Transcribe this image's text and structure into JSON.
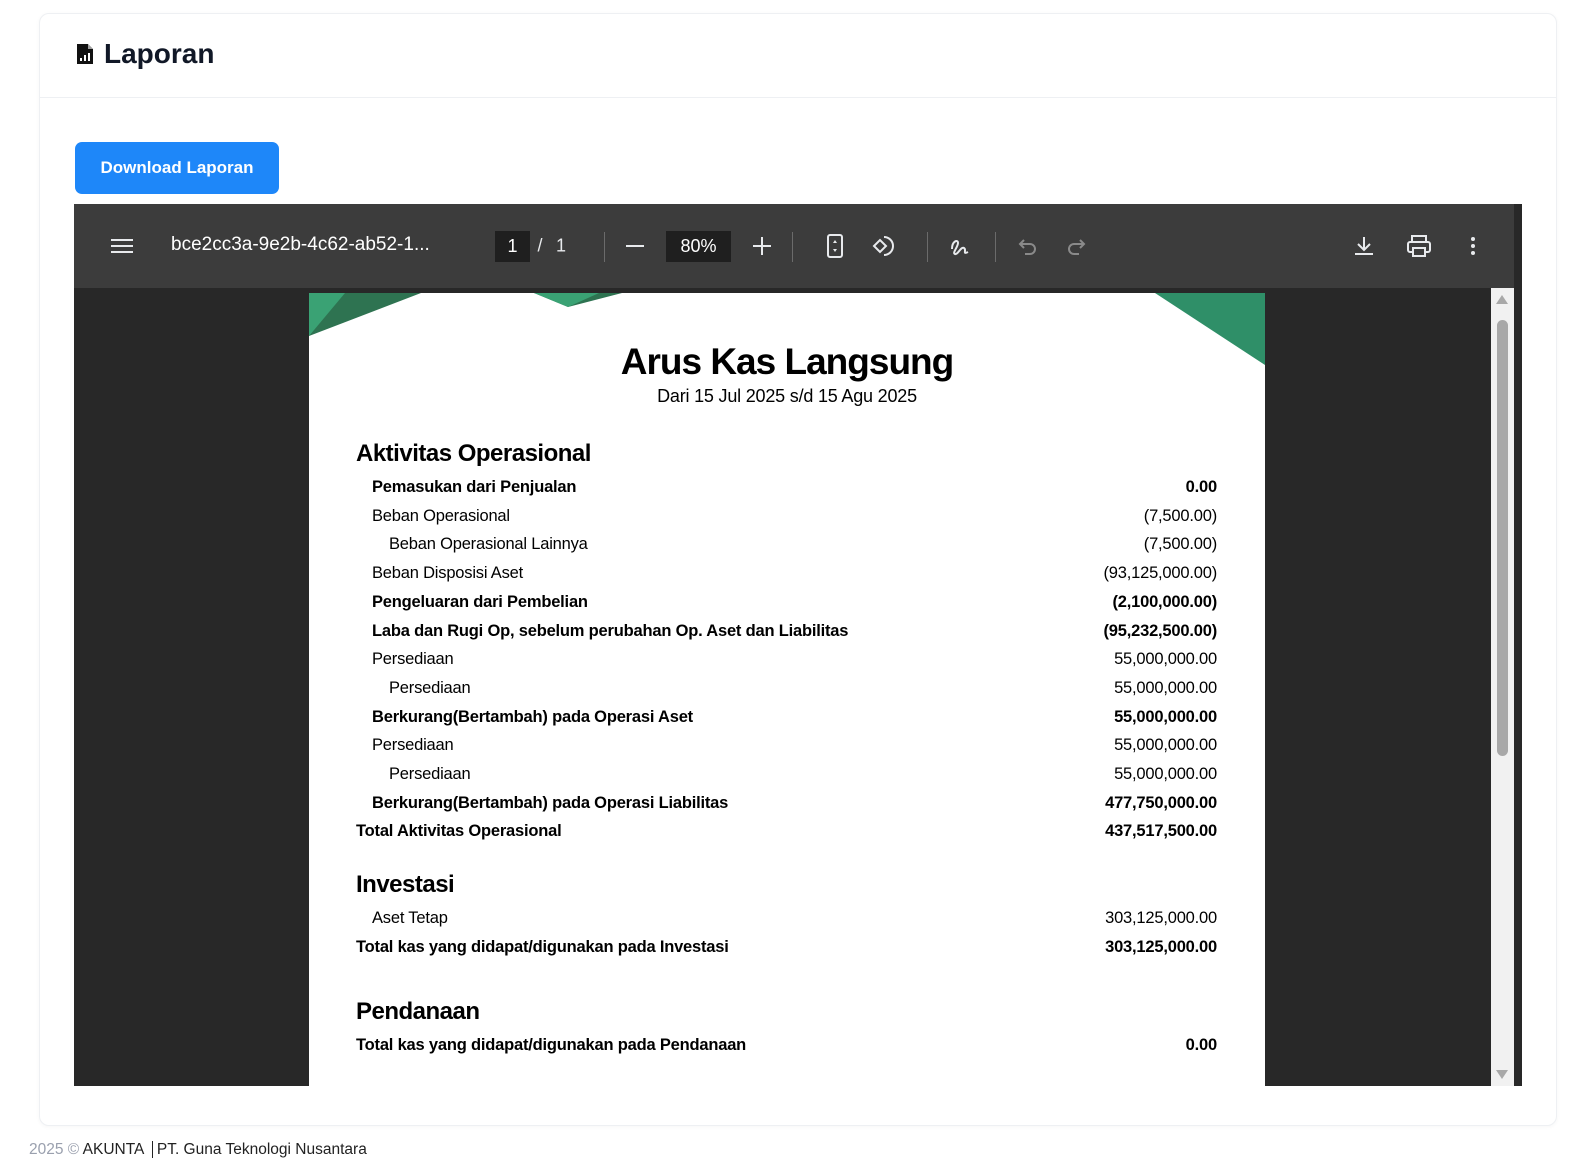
{
  "header": {
    "title": "Laporan",
    "icon": "file-chart-icon"
  },
  "download_button": "Download Laporan",
  "viewer": {
    "filename": "bce2cc3a-9e2b-4c62-ab52-1...",
    "current_page": "1",
    "page_sep": "/",
    "total_pages": "1",
    "zoom": "80%"
  },
  "document": {
    "title": "Arus Kas Langsung",
    "subtitle": "Dari 15 Jul 2025 s/d 15 Agu 2025",
    "sections": [
      {
        "heading": "Aktivitas Operasional",
        "rows": [
          {
            "label": "Pemasukan dari Penjualan",
            "value": "0.00",
            "bold": true,
            "level": 1
          },
          {
            "label": "Beban Operasional",
            "value": "(7,500.00)",
            "bold": false,
            "level": 1
          },
          {
            "label": "Beban Operasional Lainnya",
            "value": "(7,500.00)",
            "bold": false,
            "level": 2
          },
          {
            "label": "Beban Disposisi Aset",
            "value": "(93,125,000.00)",
            "bold": false,
            "level": 1
          },
          {
            "label": "Pengeluaran dari Pembelian",
            "value": "(2,100,000.00)",
            "bold": true,
            "level": 1
          },
          {
            "label": "Laba dan Rugi Op, sebelum perubahan Op. Aset dan Liabilitas",
            "value": "(95,232,500.00)",
            "bold": true,
            "level": 1
          },
          {
            "label": "Persediaan",
            "value": "55,000,000.00",
            "bold": false,
            "level": 1
          },
          {
            "label": "Persediaan",
            "value": "55,000,000.00",
            "bold": false,
            "level": 2
          },
          {
            "label": "Berkurang(Bertambah) pada Operasi Aset",
            "value": "55,000,000.00",
            "bold": true,
            "level": 1
          },
          {
            "label": "Persediaan",
            "value": "55,000,000.00",
            "bold": false,
            "level": 1
          },
          {
            "label": "Persediaan",
            "value": "55,000,000.00",
            "bold": false,
            "level": 2
          },
          {
            "label": "Berkurang(Bertambah) pada Operasi Liabilitas",
            "value": "477,750,000.00",
            "bold": true,
            "level": 1
          },
          {
            "label": "Total Aktivitas Operasional",
            "value": "437,517,500.00",
            "bold": true,
            "level": 0
          }
        ]
      },
      {
        "heading": "Investasi",
        "rows": [
          {
            "label": "Aset Tetap",
            "value": "303,125,000.00",
            "bold": false,
            "level": 1
          },
          {
            "label": "Total kas yang didapat/digunakan pada Investasi",
            "value": "303,125,000.00",
            "bold": true,
            "level": 0
          }
        ]
      },
      {
        "heading": "Pendanaan",
        "rows": [
          {
            "label": "Total kas yang didapat/digunakan pada Pendanaan",
            "value": "0.00",
            "bold": true,
            "level": 0
          }
        ]
      }
    ]
  },
  "footer": {
    "year": "2025 ©",
    "brand": "AKUNTA",
    "company": "PT. Guna Teknologi Nusantara"
  },
  "colors": {
    "primary": "#1e87f9",
    "toolbar": "#3c3c3c",
    "viewer_bg": "#282828",
    "accent_green": "#2f8f68"
  }
}
